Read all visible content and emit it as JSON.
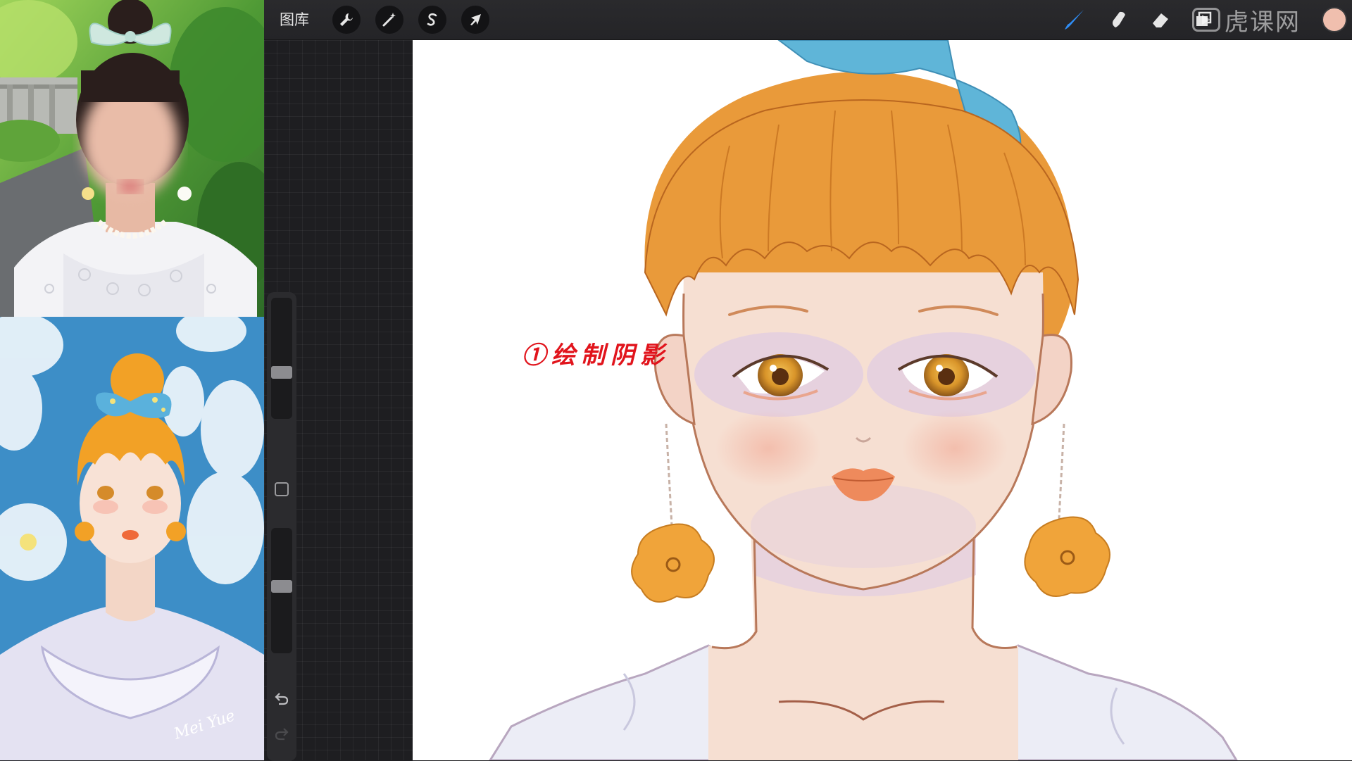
{
  "toolbar": {
    "gallery_label": "图库",
    "left_tools": [
      {
        "name": "actions",
        "icon": "wrench-icon"
      },
      {
        "name": "adjustments",
        "icon": "magic-wand-icon"
      },
      {
        "name": "selection",
        "icon": "selection-s-icon"
      },
      {
        "name": "transform",
        "icon": "arrow-cursor-icon"
      }
    ],
    "right_tools": [
      {
        "name": "brush",
        "icon": "brush-icon",
        "active": true
      },
      {
        "name": "smudge",
        "icon": "smudge-icon"
      },
      {
        "name": "eraser",
        "icon": "eraser-icon"
      },
      {
        "name": "layers",
        "icon": "layers-icon"
      }
    ],
    "active_color": "#f0bfae",
    "active_tool_color": "#2f8df5"
  },
  "watermark": {
    "brand_text": "虎课网",
    "icon": "tv-play-icon"
  },
  "sidebar": {
    "brush_size_level": 0.63,
    "brush_opacity_level": 0.46,
    "modify_icon": "square-icon",
    "undo_icon": "undo-arrow-icon",
    "redo_icon": "redo-arrow-icon"
  },
  "canvas": {
    "annotation_text": "①绘制阴影",
    "annotation_color": "#e1141c"
  },
  "colors": {
    "hair": "#e99a3a",
    "ribbon": "#5fb5d8",
    "skin": "#f6dfd2",
    "shadow": "#e3cfe0",
    "lips": "#ee8a5c",
    "outline": "#b8785a"
  }
}
